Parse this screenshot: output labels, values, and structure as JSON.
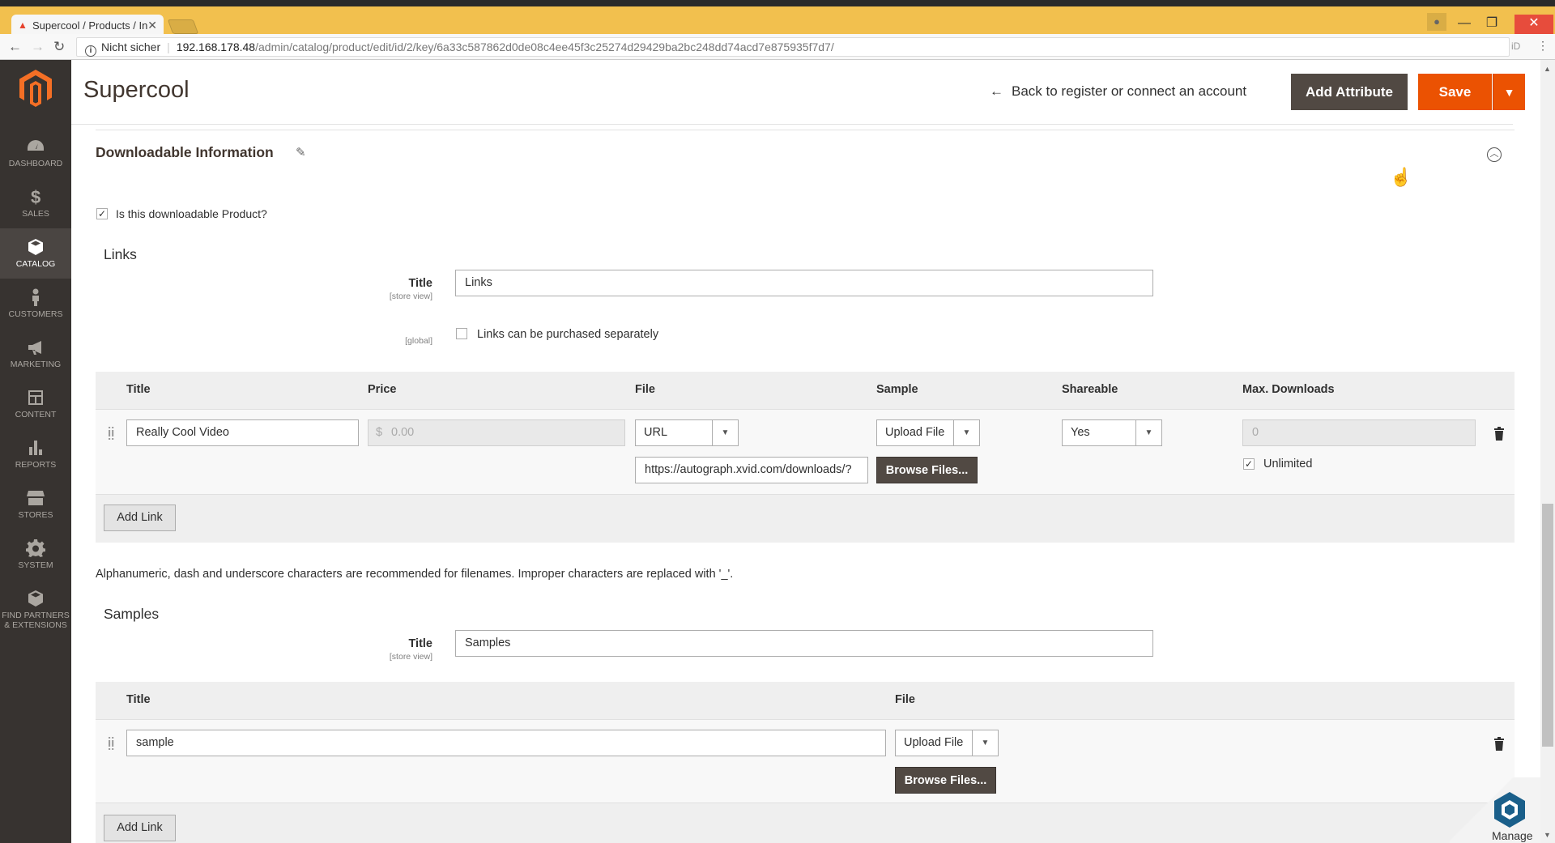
{
  "browser": {
    "tab_title": "Supercool / Products / In",
    "url_insecure_label": "Nicht sicher",
    "url_host": "192.168.178.48",
    "url_path": "/admin/catalog/product/edit/id/2/key/6a33c587862d0de08c4ee45f3c25274d29429ba2bc248dd74acd7e875935f7d7/"
  },
  "sidebar": {
    "items": [
      {
        "label": "Dashboard",
        "icon": "dashboard-icon"
      },
      {
        "label": "Sales",
        "icon": "dollar-icon"
      },
      {
        "label": "Catalog",
        "icon": "box-icon",
        "active": true
      },
      {
        "label": "Customers",
        "icon": "person-icon"
      },
      {
        "label": "Marketing",
        "icon": "megaphone-icon"
      },
      {
        "label": "Content",
        "icon": "layout-icon"
      },
      {
        "label": "Reports",
        "icon": "bar-chart-icon"
      },
      {
        "label": "Stores",
        "icon": "store-icon"
      },
      {
        "label": "System",
        "icon": "gear-icon"
      },
      {
        "label": "Find Partners",
        "label2": "& Extensions",
        "icon": "cube-icon"
      }
    ]
  },
  "header": {
    "title": "Supercool",
    "back_link": "Back to register or connect an account",
    "add_attribute": "Add Attribute",
    "save": "Save"
  },
  "section": {
    "title": "Downloadable Information",
    "is_downloadable_label": "Is this downloadable Product?",
    "is_downloadable_checked": true
  },
  "links": {
    "heading": "Links",
    "title_label": "Title",
    "title_scope": "[store view]",
    "title_value": "Links",
    "global_scope": "[global]",
    "separately_label": "Links can be purchased separately",
    "separately_checked": false,
    "columns": [
      "Title",
      "Price",
      "File",
      "Sample",
      "Shareable",
      "Max. Downloads"
    ],
    "rows": [
      {
        "title": "Really Cool Video",
        "price_currency": "$",
        "price": "0.00",
        "file_type": "URL",
        "file_url": "https://autograph.xvid.com/downloads/?",
        "browse_label": "Browse Files...",
        "sample_type": "Upload File",
        "shareable": "Yes",
        "max_downloads": "0",
        "unlimited_label": "Unlimited",
        "unlimited_checked": true
      }
    ],
    "add_link": "Add Link"
  },
  "filename_note": "Alphanumeric, dash and underscore characters are recommended for filenames. Improper characters are replaced with '_'.",
  "samples": {
    "heading": "Samples",
    "title_label": "Title",
    "title_scope": "[store view]",
    "title_value": "Samples",
    "columns": [
      "Title",
      "File"
    ],
    "rows": [
      {
        "title": "sample",
        "file_type": "Upload File",
        "browse_label": "Browse Files..."
      }
    ],
    "add_link": "Add Link"
  },
  "widget": {
    "manage_label": "Manage"
  },
  "colors": {
    "accent": "#eb5202",
    "sidebar": "#373330",
    "browser_frame": "#f2c04e"
  }
}
